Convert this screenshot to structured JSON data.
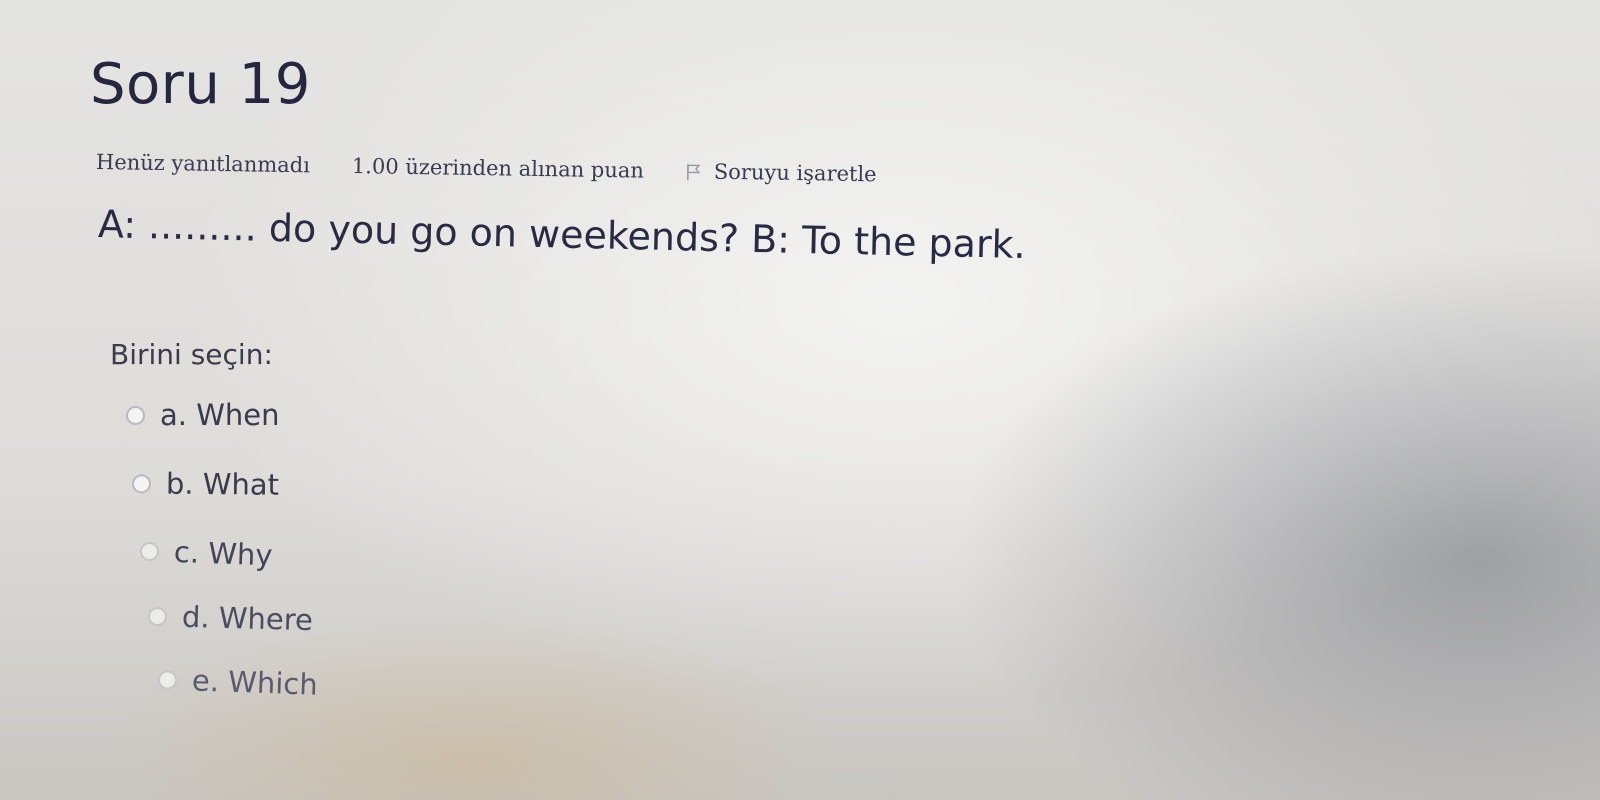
{
  "question": {
    "title": "Soru 19",
    "state": "Henüz yanıtlanmadı",
    "grade": "1.00 üzerinden alınan puan",
    "flag_label": "Soruyu işaretle",
    "text": "A: ......... do you go on weekends? B: To the park.",
    "prompt": "Birini seçin:",
    "answers": [
      {
        "label": "a. When",
        "selected": false
      },
      {
        "label": "b. What",
        "selected": false
      },
      {
        "label": "c. Why",
        "selected": false
      },
      {
        "label": "d. Where",
        "selected": false
      },
      {
        "label": "e. Which",
        "selected": false
      }
    ]
  },
  "icons": {
    "flag": "flag-icon",
    "radio": "radio-unchecked-icon"
  },
  "colors": {
    "title": "#262641",
    "text": "#2a2a44",
    "flag": "#9a9aa6"
  }
}
